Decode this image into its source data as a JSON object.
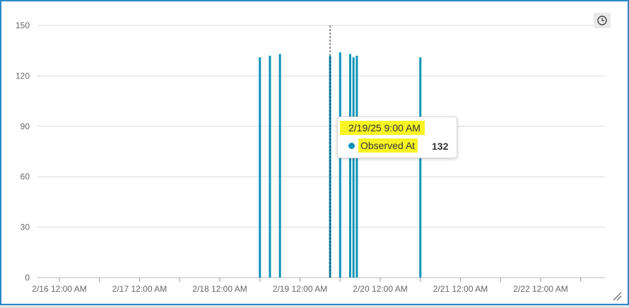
{
  "chart_data": {
    "type": "bar",
    "title": "",
    "xlabel": "",
    "ylabel": "",
    "ylim": [
      0,
      150
    ],
    "xlim": [
      "2/16/25 12:00 AM",
      "2/22/25 11:00 PM"
    ],
    "yticks": [
      "0",
      "30",
      "60",
      "90",
      "120",
      "150"
    ],
    "xticks": [
      "2/16 12:00 AM",
      "2/17 12:00 AM",
      "2/18 12:00 AM",
      "2/19 12:00 AM",
      "2/20 12:00 AM",
      "2/21 12:00 AM",
      "2/22 12:00 AM"
    ],
    "grid": true,
    "series": [
      {
        "name": "Observed At",
        "color": "#0e92b8",
        "points": [
          {
            "x": "2/18/25 12:00 PM",
            "y": 131
          },
          {
            "x": "2/18/25 3:00 PM",
            "y": 132
          },
          {
            "x": "2/18/25 6:00 PM",
            "y": 133
          },
          {
            "x": "2/19/25 9:00 AM",
            "y": 132
          },
          {
            "x": "2/19/25 12:00 PM",
            "y": 134
          },
          {
            "x": "2/19/25 3:00 PM",
            "y": 133
          },
          {
            "x": "2/19/25 4:00 PM",
            "y": 131
          },
          {
            "x": "2/19/25 5:00 PM",
            "y": 132
          },
          {
            "x": "2/20/25 12:00 PM",
            "y": 131
          }
        ]
      }
    ],
    "crosshair_x": "2/19/25 9:00 AM"
  },
  "tooltip": {
    "title": "2/19/25 9:00 AM",
    "series_name": "Observed At",
    "value": "132",
    "highlight_color": "#f7f423"
  },
  "colors": {
    "frame_border": "#2b88c8",
    "grid": "#d9d9d9",
    "bar": "#0e92b8"
  },
  "icons": {
    "time_button": "clock-icon",
    "resize": "resize-grip-icon"
  }
}
